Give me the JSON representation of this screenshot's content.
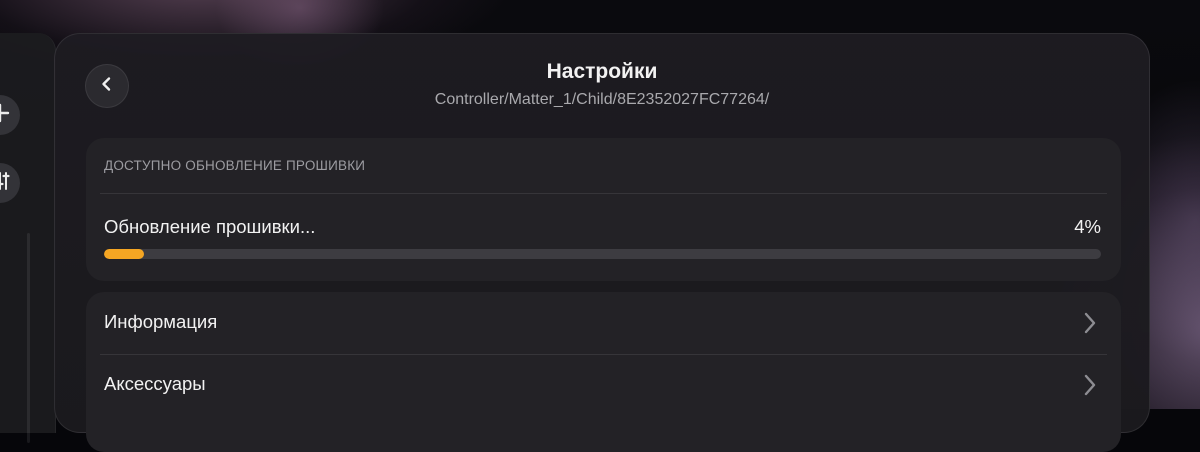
{
  "header": {
    "title": "Настройки",
    "path": "Controller/Matter_1/Child/8E2352027FC77264/"
  },
  "sidebar": {
    "buttons": [
      {
        "icon": "plus-icon"
      },
      {
        "icon": "sliders-icon"
      }
    ]
  },
  "firmware": {
    "section_label": "ДОСТУПНО ОБНОВЛЕНИЕ ПРОШИВКИ",
    "status_text": "Обновление прошивки...",
    "percent_label": "4%",
    "progress": 0.04,
    "progress_color": "#f5a623"
  },
  "menu": {
    "items": [
      {
        "label": "Информация",
        "icon": "chevron-right-icon"
      },
      {
        "label": "Аксессуары",
        "icon": "chevron-right-icon"
      }
    ]
  },
  "colors": {
    "panel_bg": "#1e1d22",
    "card_bg": "#232226",
    "accent": "#f5a623"
  }
}
